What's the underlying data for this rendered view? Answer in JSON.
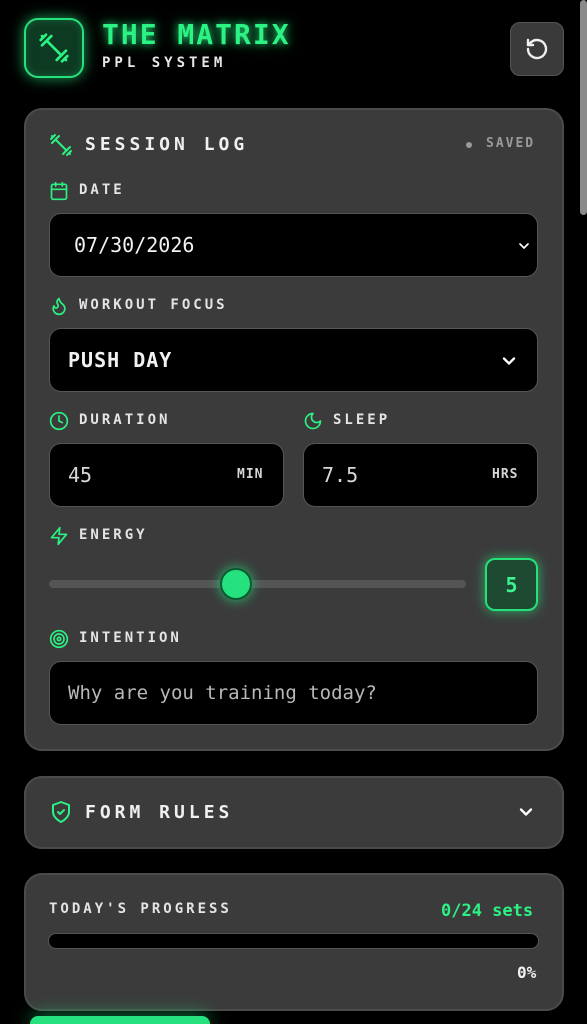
{
  "header": {
    "title": "THE MATRIX",
    "subtitle": "PPL SYSTEM",
    "logo_icon": "dumbbell-icon",
    "reset_icon": "rotate-ccw-icon"
  },
  "session": {
    "title": "SESSION LOG",
    "status": "SAVED",
    "date": {
      "label": "DATE",
      "value": "07/30/2026"
    },
    "focus": {
      "label": "WORKOUT FOCUS",
      "value": "PUSH DAY"
    },
    "duration": {
      "label": "DURATION",
      "value": "45",
      "unit": "MIN"
    },
    "sleep": {
      "label": "SLEEP",
      "value": "7.5",
      "unit": "HRS"
    },
    "energy": {
      "label": "ENERGY",
      "value": "5",
      "level": 0.45
    },
    "intention": {
      "label": "INTENTION",
      "placeholder": "Why are you training today?"
    }
  },
  "rules": {
    "title": "FORM RULES"
  },
  "progress": {
    "title": "TODAY'S PROGRESS",
    "count": "0/24 sets",
    "percent": "0%",
    "fraction": 0
  },
  "colors": {
    "accent": "#26e07a",
    "card": "#3b3b3b",
    "field": "#000000",
    "background": "#000000"
  }
}
